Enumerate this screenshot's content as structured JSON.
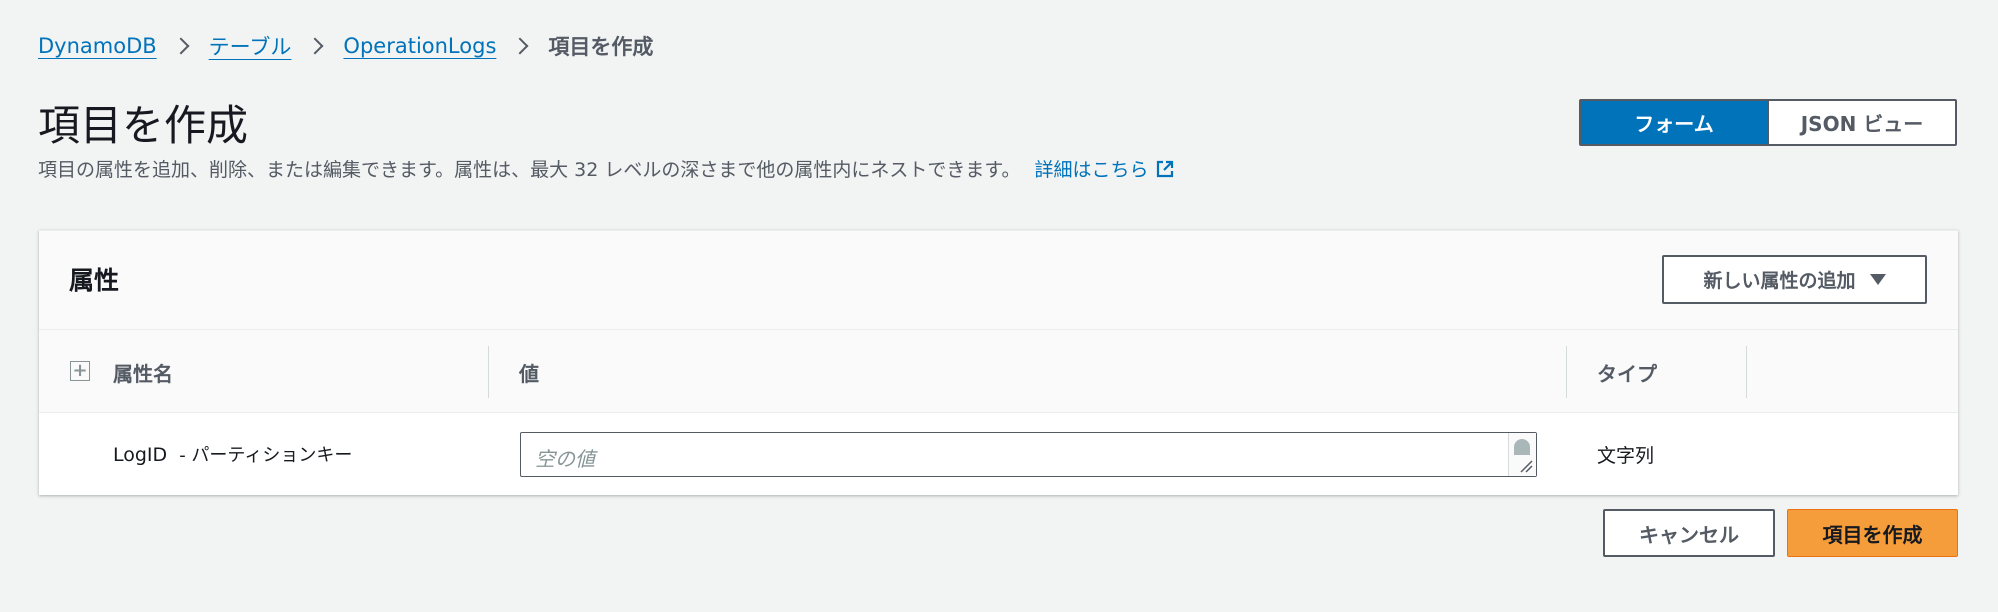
{
  "breadcrumb": {
    "items": [
      "DynamoDB",
      "テーブル",
      "OperationLogs"
    ],
    "current": "項目を作成"
  },
  "header": {
    "title": "項目を作成",
    "description": "項目の属性を追加、削除、または編集できます。属性は、最大 32 レベルの深さまで他の属性内にネストできます。",
    "learn_more": "詳細はこちら"
  },
  "view_toggle": {
    "form_label": "フォーム",
    "json_label": "JSON ビュー",
    "selected": "フォーム"
  },
  "attributes_panel": {
    "title": "属性",
    "add_button_label": "新しい属性の追加",
    "columns": {
      "name": "属性名",
      "value": "値",
      "type": "タイプ"
    },
    "rows": [
      {
        "name": "LogID",
        "key_label": "- パーティションキー",
        "value": "",
        "placeholder": "空の値",
        "type": "文字列"
      }
    ]
  },
  "footer": {
    "cancel_label": "キャンセル",
    "create_label": "項目を作成"
  },
  "colors": {
    "link": "#0073bb",
    "primary": "#f49d3a",
    "toggle_active": "#0073bb",
    "background": "#f2f3f3"
  }
}
